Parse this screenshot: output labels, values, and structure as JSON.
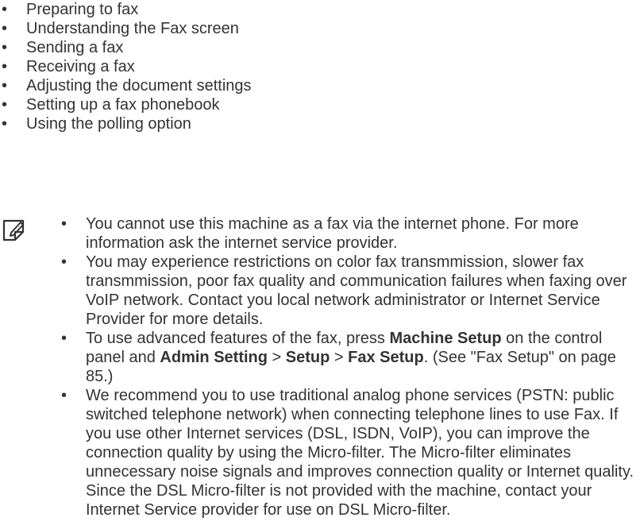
{
  "toc": {
    "bullet": "•",
    "items": [
      {
        "label": "Preparing to fax"
      },
      {
        "label": "Understanding the Fax screen"
      },
      {
        "label": "Sending a fax"
      },
      {
        "label": "Receiving a fax"
      },
      {
        "label": "Adjusting the document settings"
      },
      {
        "label": "Setting up a fax phonebook"
      },
      {
        "label": "Using the polling option"
      }
    ]
  },
  "note": {
    "icon": "note-pencil-icon",
    "items": [
      {
        "text": "You cannot use this machine as a fax via the internet phone. For more information ask the internet service provider."
      },
      {
        "text": "You may experience restrictions on color fax transmmission, slower fax transmmission, poor fax quality and communication failures when faxing over VoIP network. Contact you local network administrator or Internet Service Provider for more details."
      },
      {
        "t1": "To use advanced features of the fax, press ",
        "b1": "Machine Setup",
        "t2": " on the control panel and ",
        "b2": "Admin Setting",
        "t3": " > ",
        "b3": "Setup",
        "t4": " > ",
        "b4": "Fax Setup",
        "t5": ". (See \"Fax Setup\" on page 85.)"
      },
      {
        "text": "We recommend you to use traditional analog phone services (PSTN: public switched telephone network) when connecting telephone lines to use Fax. If you use other Internet services (DSL, ISDN, VoIP), you can improve the connection quality by using the Micro-filter. The Micro-filter eliminates unnecessary noise signals and improves connection quality or Internet quality. Since the DSL Micro-filter is not provided with the machine, contact your Internet Service provider for use on DSL Micro-filter."
      }
    ]
  },
  "colors": {
    "text": "#333333",
    "background": "#ffffff"
  }
}
